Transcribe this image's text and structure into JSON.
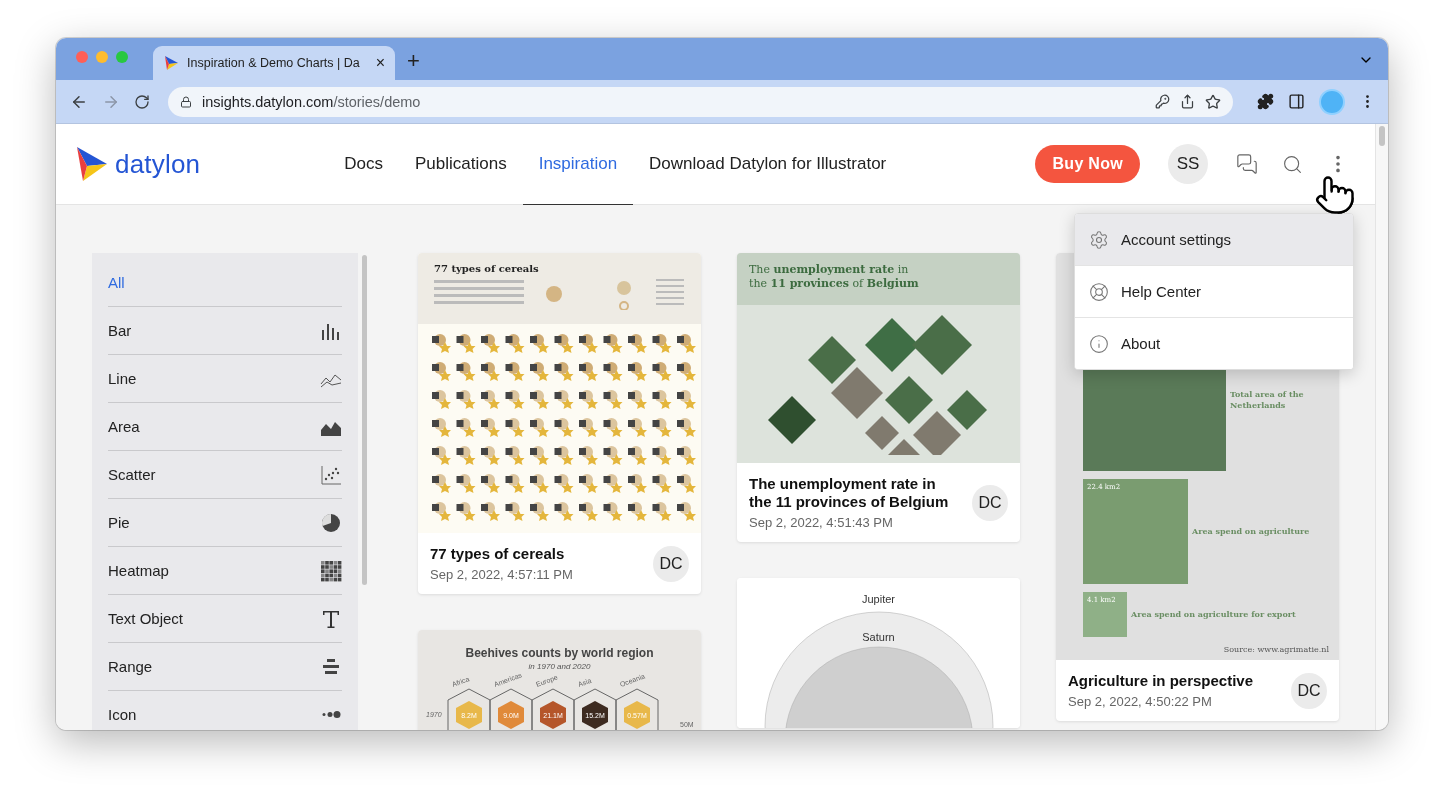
{
  "browser": {
    "tab": {
      "title": "Inspiration & Demo Charts | Da",
      "close": "×"
    },
    "new_tab": "+",
    "address": {
      "host": "insights.datylon.com",
      "path": "/stories/demo"
    }
  },
  "header": {
    "logo": "datylon",
    "nav": [
      {
        "label": "Docs",
        "selected": false
      },
      {
        "label": "Publications",
        "selected": false
      },
      {
        "label": "Inspiration",
        "selected": true
      },
      {
        "label": "Download Datylon for Illustrator",
        "selected": false
      }
    ],
    "buy_button": "Buy Now",
    "avatar": "SS"
  },
  "menu": {
    "items": [
      {
        "label": "Account settings",
        "kind": "settings",
        "selected": true
      },
      {
        "label": "Help Center",
        "kind": "help",
        "selected": false
      },
      {
        "label": "About",
        "kind": "about",
        "selected": false
      }
    ]
  },
  "sidebar": {
    "items": [
      {
        "label": "All",
        "kind": "all",
        "selected": true
      },
      {
        "label": "Bar",
        "kind": "bar",
        "selected": false
      },
      {
        "label": "Line",
        "kind": "line",
        "selected": false
      },
      {
        "label": "Area",
        "kind": "area",
        "selected": false
      },
      {
        "label": "Scatter",
        "kind": "scatter",
        "selected": false
      },
      {
        "label": "Pie",
        "kind": "pie",
        "selected": false
      },
      {
        "label": "Heatmap",
        "kind": "heatmap",
        "selected": false
      },
      {
        "label": "Text Object",
        "kind": "text",
        "selected": false
      },
      {
        "label": "Range",
        "kind": "range",
        "selected": false
      },
      {
        "label": "Icon",
        "kind": "icon",
        "selected": false
      }
    ]
  },
  "columns": [
    [
      {
        "kind": "cereals",
        "heading": "77 types of cereals",
        "title": "77 types of cereals",
        "date": "Sep 2, 2022, 4:57:11 PM",
        "author": "DC"
      },
      {
        "kind": "beehives",
        "heading": "Beehives counts by world region",
        "subheading": "in 1970 and 2020",
        "year": "1970",
        "scale": "50M",
        "regions": [
          {
            "name": "Africa",
            "value": "8.2M",
            "color": "#e8b84a"
          },
          {
            "name": "Americas",
            "value": "9.0M",
            "color": "#e08a3a"
          },
          {
            "name": "Europe",
            "value": "21.1M",
            "color": "#b5562a"
          },
          {
            "name": "Asia",
            "value": "15.2M",
            "color": "#3d2b20"
          },
          {
            "name": "Oceania",
            "value": "0.57M",
            "color": "#e8b84a"
          }
        ]
      }
    ],
    [
      {
        "kind": "unemployment",
        "heading": "The **unemployment rate** in the **11 provinces** of **Belgium**",
        "title": "The unemployment rate in the 11 provinces of Belgium",
        "date": "Sep 2, 2022, 4:51:43 PM",
        "author": "DC"
      },
      {
        "kind": "planets",
        "labels": [
          "Jupiter",
          "Saturn"
        ]
      }
    ],
    [
      {
        "kind": "agriculture",
        "areas": [
          {
            "label": "Total area of the Netherlands"
          },
          {
            "value": "22.4 km2",
            "label": "Area spend on agriculture"
          },
          {
            "value": "4.1 km2",
            "label": "Area spend on agriculture for export"
          }
        ],
        "source": "Source: www.agrimatie.nl",
        "title": "Agriculture in perspective",
        "date": "Sep 2, 2022, 4:50:22 PM",
        "author": "DC"
      }
    ]
  ]
}
